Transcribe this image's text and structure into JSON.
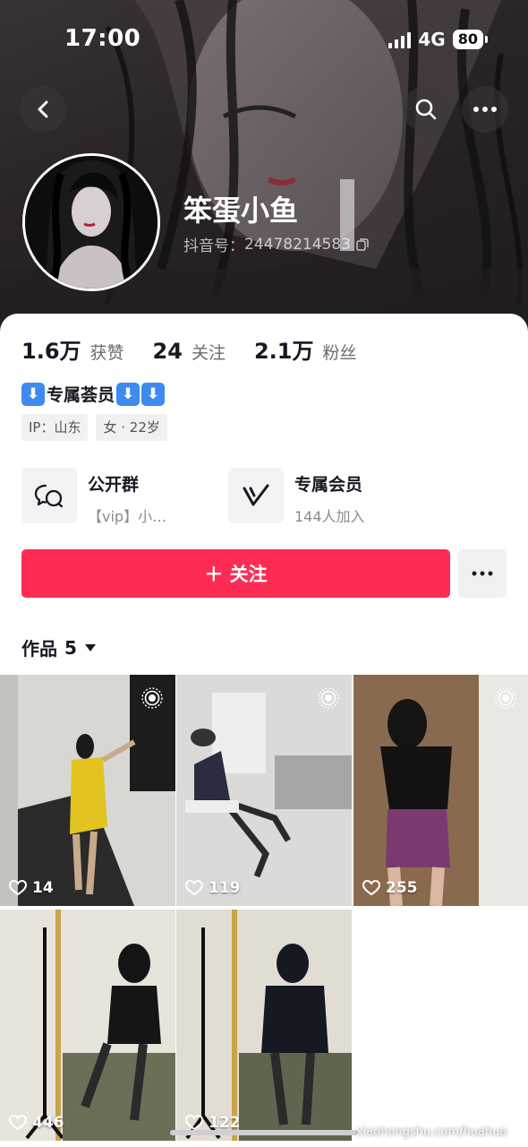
{
  "status_bar": {
    "time": "17:00",
    "network": "4G",
    "battery": "80"
  },
  "profile": {
    "nickname": "笨蛋小鱼",
    "douyin_id_label": "抖音号：",
    "douyin_id": "24478214583",
    "stats": [
      {
        "value": "1.6万",
        "label": "获赞"
      },
      {
        "value": "24",
        "label": "关注"
      },
      {
        "value": "2.1万",
        "label": "粉丝"
      }
    ],
    "bio": "专属荟员",
    "tags": [
      "IP：山东",
      "女 · 22岁"
    ]
  },
  "entries": [
    {
      "title": "公开群",
      "subtitle": "【vip】小…",
      "icon": "chat-group-icon"
    },
    {
      "title": "专属会员",
      "subtitle": "144人加入",
      "icon": "v-member-icon"
    }
  ],
  "actions": {
    "follow_label": "＋ 关注"
  },
  "works": {
    "label": "作品",
    "count": "5",
    "items": [
      {
        "likes": "14",
        "palette": [
          "#d9d7d3",
          "#e2c320"
        ]
      },
      {
        "likes": "119",
        "palette": [
          "#dcdad8",
          "#2a2c40"
        ]
      },
      {
        "likes": "255",
        "palette": [
          "#8a6a4e",
          "#7a3a70"
        ]
      },
      {
        "likes": "446",
        "palette": [
          "#e7e4dc",
          "#151515"
        ]
      },
      {
        "likes": "122",
        "palette": [
          "#e2ddd3",
          "#161822"
        ]
      }
    ]
  },
  "watermark": "xiaohongshu.com/huahua",
  "colors": {
    "accent": "#fe2c55",
    "bio_arrow": "#3e8bf0"
  }
}
